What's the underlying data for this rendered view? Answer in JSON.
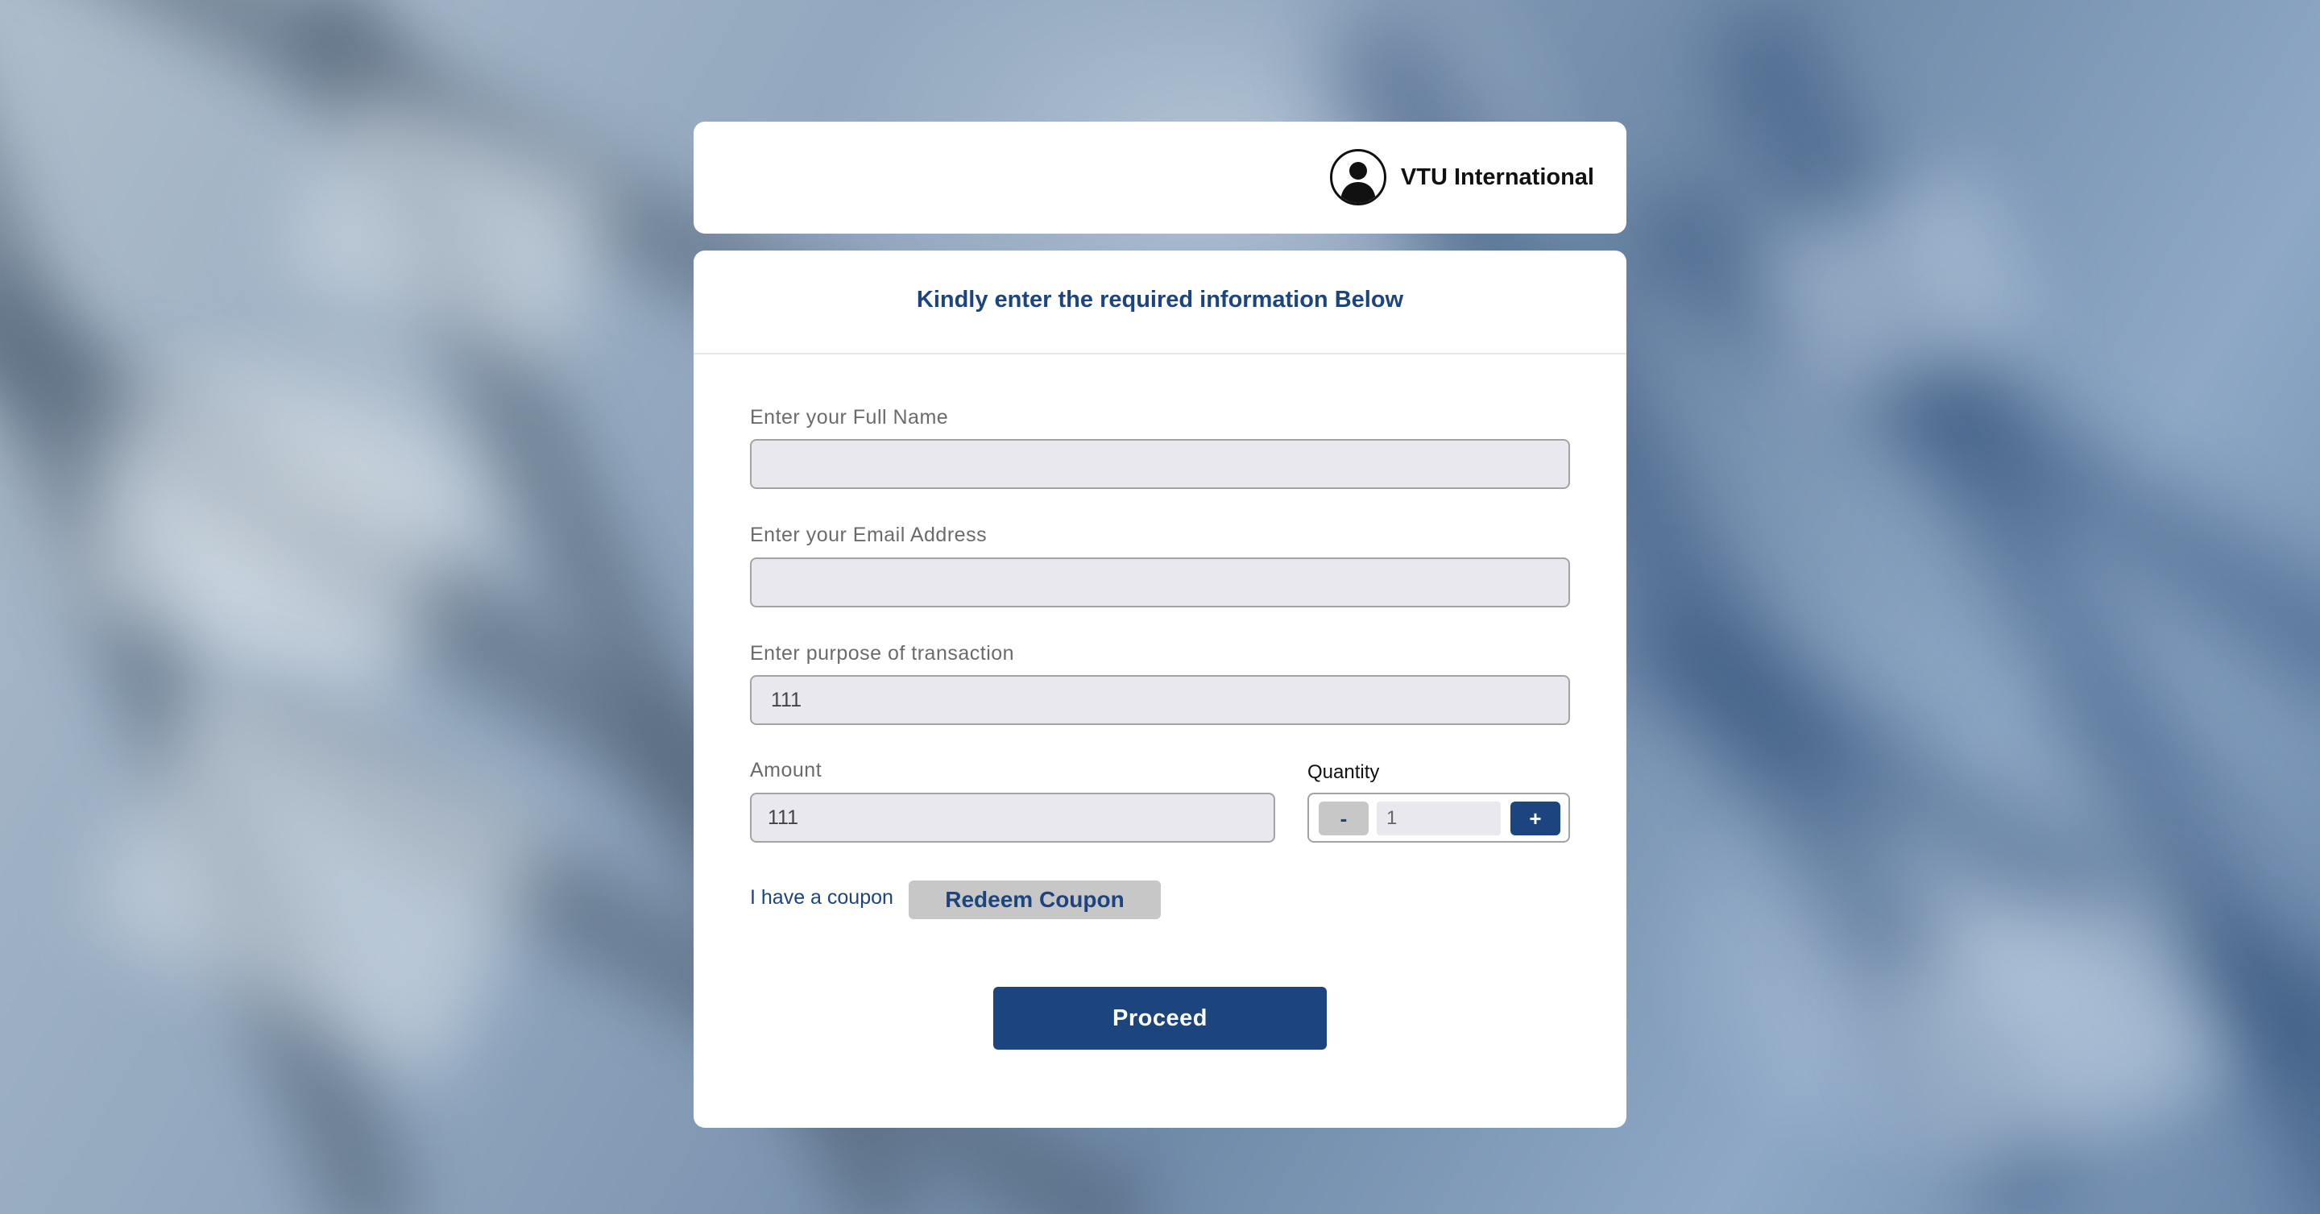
{
  "header": {
    "brand_name": "VTU International",
    "avatar_icon": "user-silhouette-icon"
  },
  "form": {
    "title": "Kindly enter the required information Below",
    "full_name": {
      "label": "Enter your Full Name",
      "value": ""
    },
    "email": {
      "label": "Enter your Email Address",
      "value": ""
    },
    "purpose": {
      "label": "Enter purpose of transaction",
      "value": "111"
    },
    "amount": {
      "label": "Amount",
      "value": "111"
    },
    "quantity": {
      "label": "Quantity",
      "minus_label": "-",
      "value": "1",
      "plus_label": "+"
    },
    "coupon": {
      "text": "I have a coupon",
      "button_label": "Redeem Coupon"
    },
    "proceed_label": "Proceed"
  },
  "colors": {
    "accent": "#1c4580",
    "input_bg": "#e8e8ee",
    "secondary_button": "#c7c7c7"
  }
}
